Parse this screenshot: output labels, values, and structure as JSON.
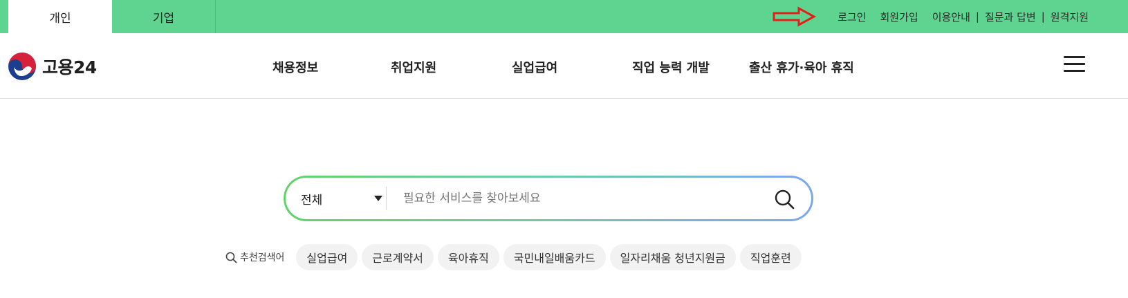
{
  "colors": {
    "topbar": "#5fd490",
    "annotation_arrow": "#e0201a",
    "search_gradient": [
      "#5fd46a",
      "#7ea6ef"
    ]
  },
  "topbar": {
    "tabs": [
      {
        "label": "개인",
        "active": true
      },
      {
        "label": "기업",
        "active": false
      }
    ],
    "utility": {
      "login": "로그인",
      "signup": "회원가입",
      "guide": "이용안내",
      "qna": "질문과 답변",
      "remote": "원격지원",
      "separator": "|"
    }
  },
  "header": {
    "logo_text": "고용24",
    "nav": [
      "채용정보",
      "취업지원",
      "실업급여",
      "직업 능력 개발",
      "출산 휴가·육아 휴직"
    ],
    "menu_icon": "hamburger-icon"
  },
  "search": {
    "scope_selected": "전체",
    "placeholder": "필요한 서비스를 찾아보세요",
    "value": "",
    "button_icon": "search-icon"
  },
  "recommended": {
    "label": "추천검색어",
    "keywords": [
      "실업급여",
      "근로계약서",
      "육아휴직",
      "국민내일배움카드",
      "일자리채움 청년지원금",
      "직업훈련"
    ]
  }
}
